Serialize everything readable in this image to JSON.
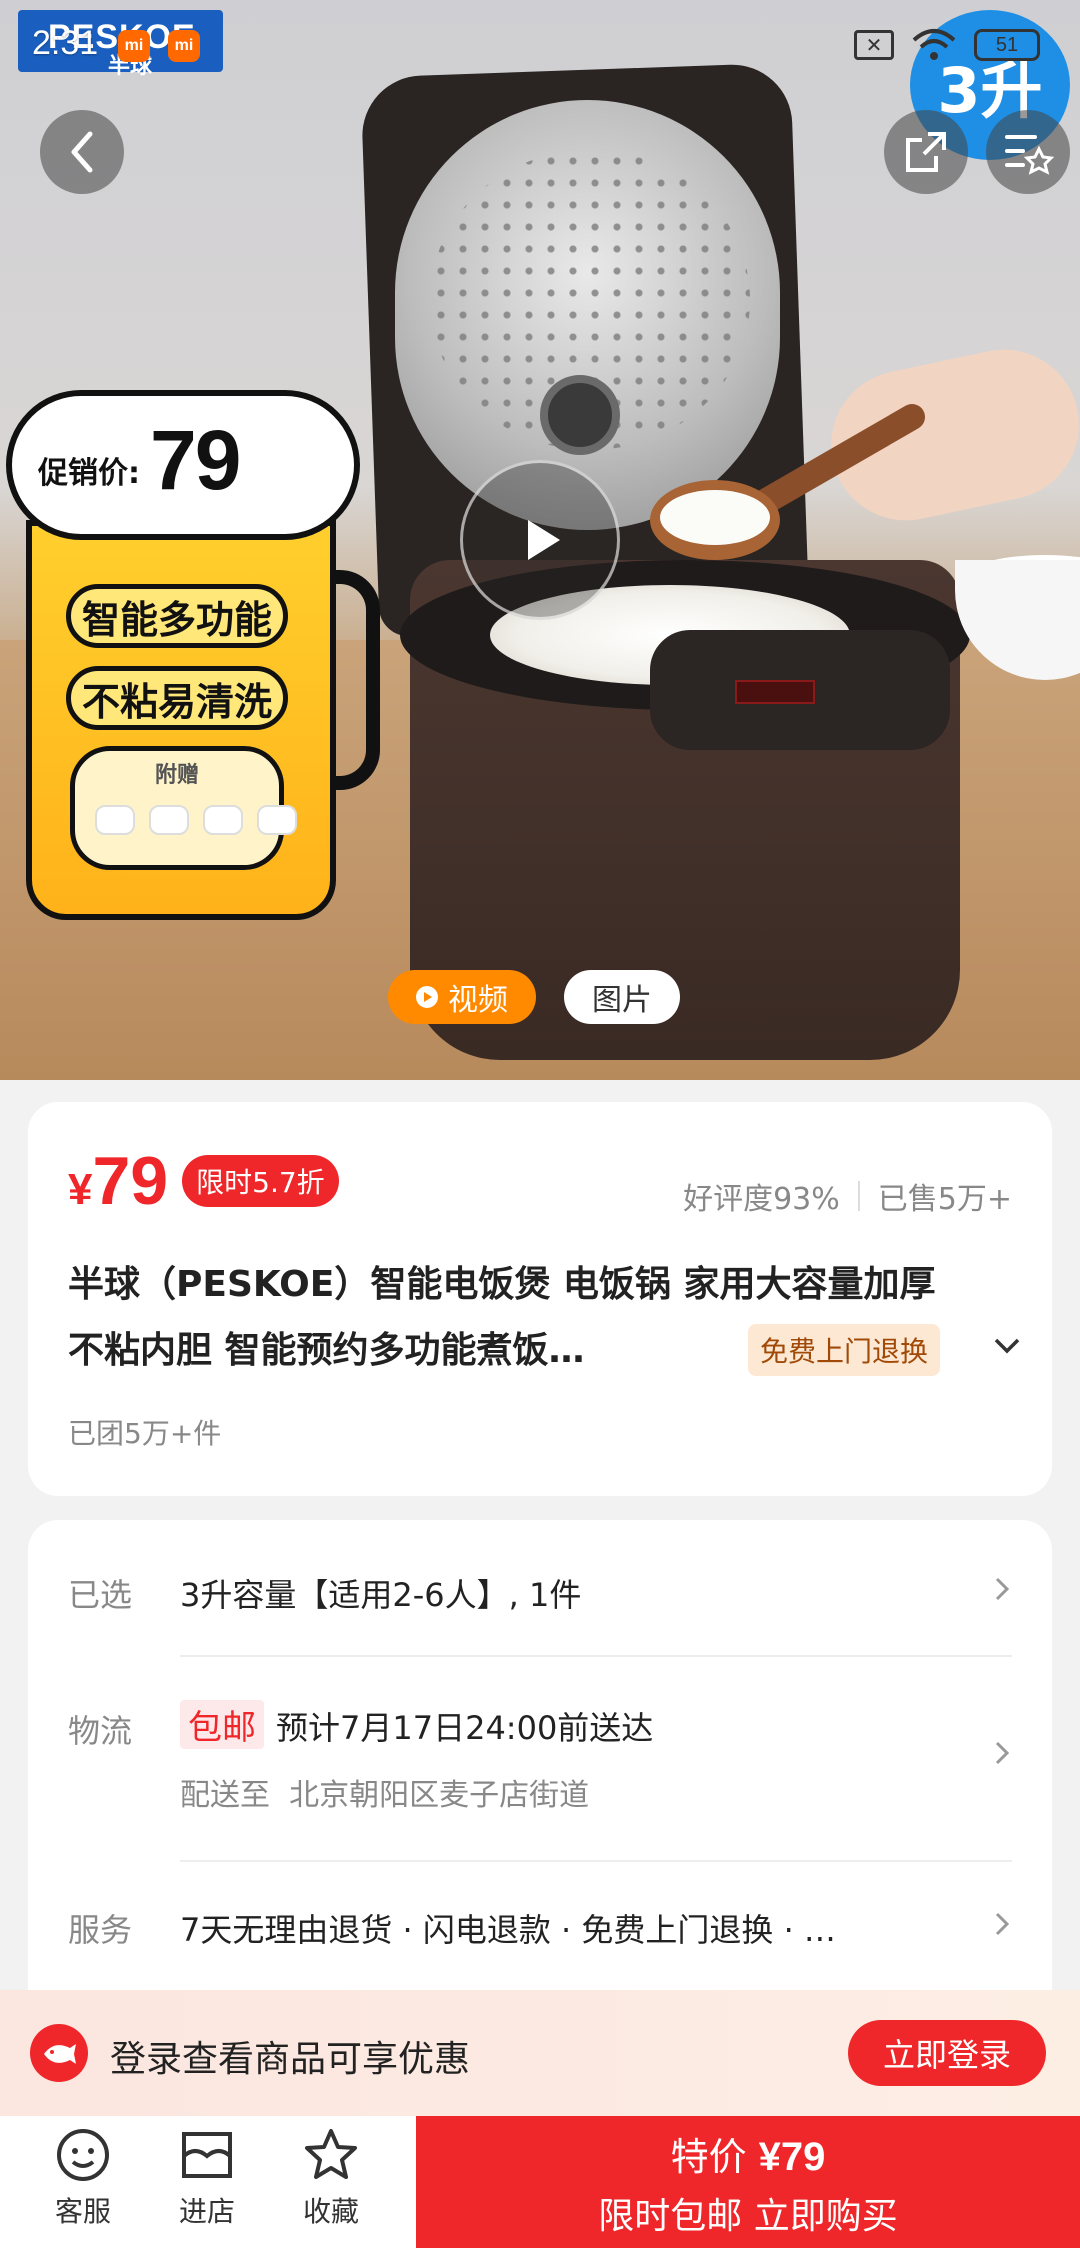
{
  "status_bar": {
    "time": "2:31",
    "mi_badge_1": "mi",
    "mi_badge_2": "mi",
    "battery": "51"
  },
  "hero": {
    "brand_logo": "PESKOE",
    "brand_logo_sub": "半球",
    "capacity_badge": "3升",
    "promo": {
      "price_label": "促销价:",
      "price": "79",
      "tag_1": "智能多功能",
      "tag_2": "不粘易清洗",
      "gift_label": "附赠"
    },
    "media_tabs": [
      {
        "label": "视频",
        "active": true
      },
      {
        "label": "图片",
        "active": false
      }
    ]
  },
  "price_card": {
    "currency": "¥",
    "price": "79",
    "discount": "限时5.7折",
    "rating": "好评度93%",
    "sold": "已售5万+",
    "title": "半球（PESKOE）智能电饭煲 电饭锅 家用大容量加厚不粘内胆 智能预约多功能煮饭…",
    "free_return_tag": "免费上门退换",
    "group_count": "已团5万+件"
  },
  "info_card": {
    "selected": {
      "label": "已选",
      "value": "3升容量【适用2-6人】, 1件"
    },
    "shipping": {
      "label": "物流",
      "badge": "包邮",
      "value": "预计7月17日24:00前送达",
      "sub_label": "配送至",
      "address": "北京朝阳区麦子店街道"
    },
    "service": {
      "label": "服务",
      "value": "7天无理由退货 · 闪电退款 · 免费上门退换 · …"
    }
  },
  "login_banner": {
    "text": "登录查看商品可享优惠",
    "button": "立即登录"
  },
  "bottom_bar": {
    "nav": [
      {
        "label": "客服",
        "icon": "customer-service-icon"
      },
      {
        "label": "进店",
        "icon": "store-icon"
      },
      {
        "label": "收藏",
        "icon": "star-icon"
      }
    ],
    "buy_prefix": "特价",
    "buy_price": "¥79",
    "buy_line2": "限时包邮 立即购买"
  },
  "colors": {
    "accent_red": "#f0272a",
    "orange": "#ff8a00",
    "promo_yellow": "#ffcf2d",
    "badge_blue": "#1e8fe4"
  }
}
